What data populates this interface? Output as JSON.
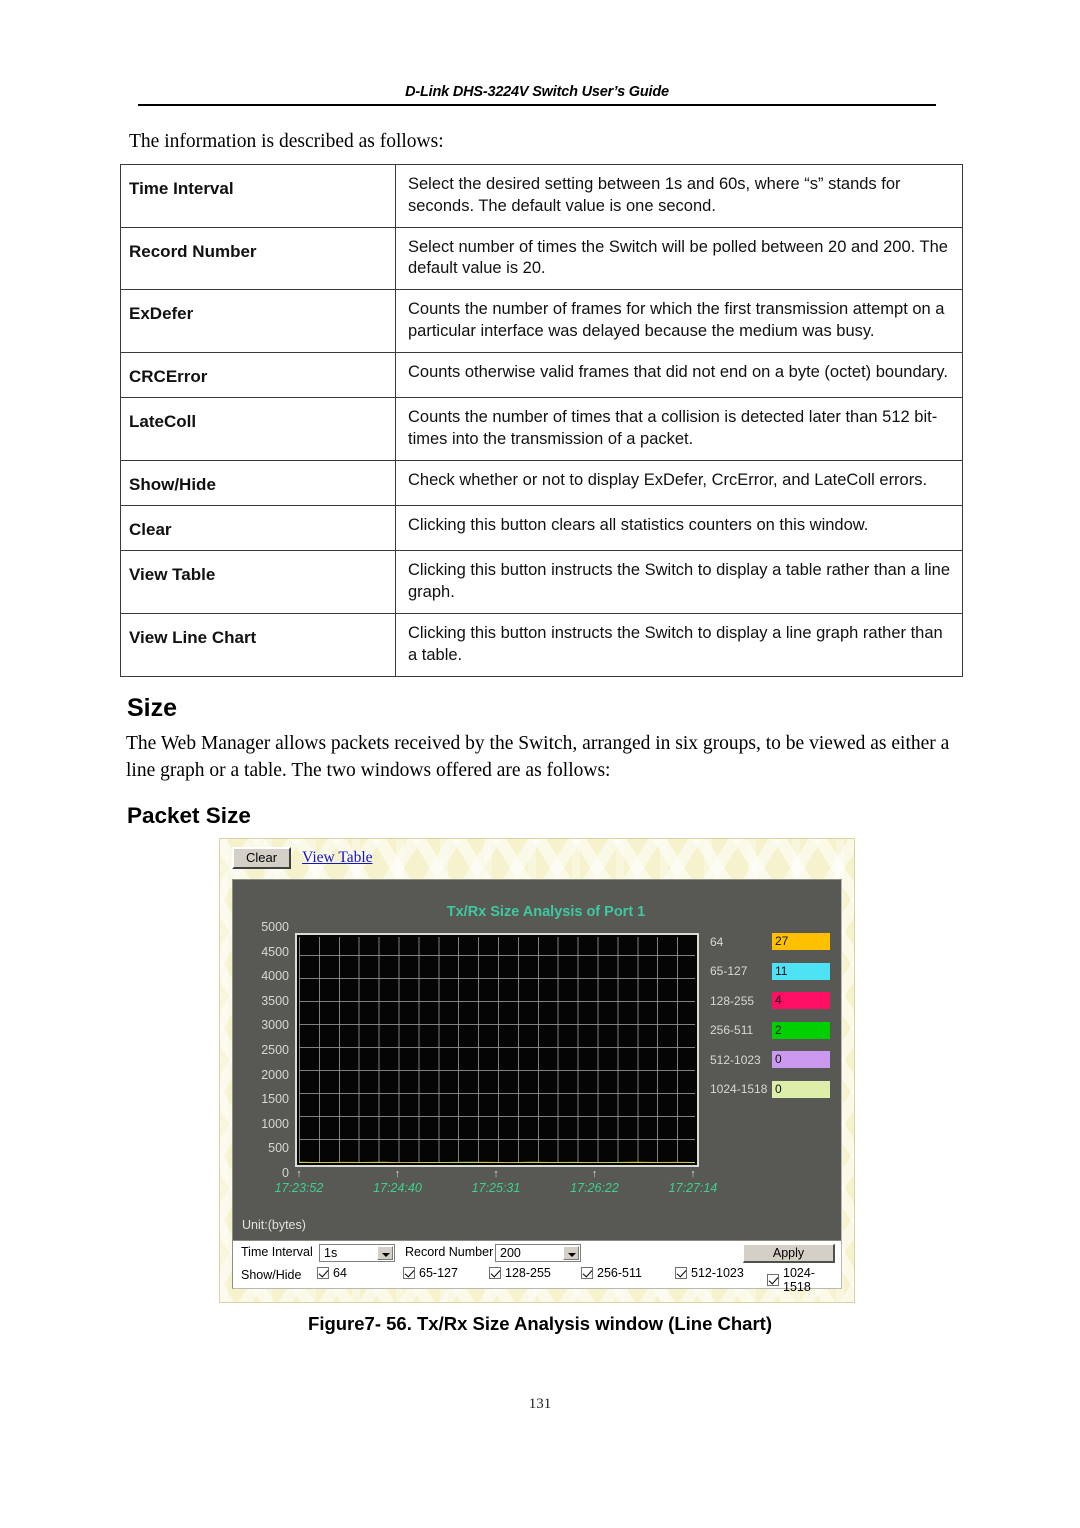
{
  "header": {
    "running_head": "D-Link DHS-3224V Switch User’s Guide"
  },
  "intro_line": "The information is described as follows:",
  "desc_table": {
    "rows": [
      {
        "term": "Time Interval",
        "definition": "Select the desired setting between 1s and 60s, where “s” stands for seconds. The default value is one second."
      },
      {
        "term": "Record Number",
        "definition": "Select number of times the Switch will be polled between 20 and 200. The default value is 20."
      },
      {
        "term": "ExDefer",
        "definition": "Counts the number of frames for which the first transmission attempt on a particular interface was delayed because the medium was busy."
      },
      {
        "term": "CRCError",
        "definition": "Counts otherwise valid frames that did not end on a byte (octet) boundary."
      },
      {
        "term": "LateColl",
        "definition": "Counts the number of times that a collision is detected later than 512 bit-times into the transmission of a packet."
      },
      {
        "term": "Show/Hide",
        "definition": "Check whether or not to display ExDefer, CrcError, and LateColl errors."
      },
      {
        "term": "Clear",
        "definition": "Clicking this button clears all statistics counters on this window."
      },
      {
        "term": "View Table",
        "definition": "Clicking this button instructs the Switch to display a table rather than a line graph."
      },
      {
        "term": "View Line Chart",
        "definition": "Clicking this button instructs the Switch to display a line graph rather than a table."
      }
    ]
  },
  "sections": {
    "size_heading": "Size",
    "size_paragraph": "The Web Manager allows packets received by the Switch, arranged in six groups, to be viewed as either a line graph or a table. The two windows offered are as follows:",
    "packet_size_heading": "Packet Size"
  },
  "screenshot": {
    "toolbar": {
      "clear_label": "Clear",
      "view_table_label": "View Table"
    },
    "unit_label": "Unit:(bytes)",
    "controls": {
      "time_interval_label": "Time Interval",
      "time_interval_value": "1s",
      "record_number_label": "Record Number",
      "record_number_value": "200",
      "apply_label": "Apply",
      "show_hide_label": "Show/Hide",
      "checkboxes": [
        {
          "label": "64",
          "checked": true
        },
        {
          "label": "65-127",
          "checked": true
        },
        {
          "label": "128-255",
          "checked": true
        },
        {
          "label": "256-511",
          "checked": true
        },
        {
          "label": "512-1023",
          "checked": true
        },
        {
          "label": "1024-1518",
          "checked": true
        }
      ]
    }
  },
  "chart_data": {
    "type": "line",
    "title": "Tx/Rx Size Analysis of Port 1",
    "xlabel": "",
    "ylabel": "",
    "unit": "Unit:(bytes)",
    "ylim": [
      0,
      5000
    ],
    "yticks": [
      5000,
      4500,
      4000,
      3500,
      3000,
      2500,
      2000,
      1500,
      1000,
      500,
      0
    ],
    "xticks": [
      "17:23:52",
      "17:24:40",
      "17:25:31",
      "17:26:22",
      "17:27:14"
    ],
    "grid": true,
    "legend_position": "right",
    "plot_background": "#050505",
    "panel_background": "#585855",
    "title_color": "#3ec9a0",
    "xtick_color": "#3fd08a",
    "series": [
      {
        "name": "64",
        "current_value": 27,
        "color": "#ffc000",
        "values": [
          30,
          24,
          29,
          26,
          31,
          22,
          27,
          25,
          33,
          28,
          24,
          30,
          26,
          29,
          23,
          27,
          31,
          25,
          28,
          27
        ]
      },
      {
        "name": "65-127",
        "current_value": 11,
        "color": "#4de3f5",
        "values": [
          12,
          9,
          14,
          10,
          13,
          8,
          11,
          12,
          15,
          9,
          11,
          13,
          10,
          12,
          9,
          14,
          11,
          10,
          13,
          11
        ]
      },
      {
        "name": "128-255",
        "current_value": 4,
        "color": "#ff0f63",
        "values": [
          5,
          3,
          6,
          2,
          4,
          7,
          3,
          5,
          4,
          2,
          6,
          3,
          5,
          4,
          3,
          5,
          2,
          4,
          6,
          4
        ]
      },
      {
        "name": "256-511",
        "current_value": 2,
        "color": "#00d000",
        "values": [
          2,
          1,
          3,
          2,
          1,
          2,
          4,
          2,
          1,
          3,
          2,
          1,
          2,
          3,
          2,
          1,
          2,
          3,
          1,
          2
        ]
      },
      {
        "name": "512-1023",
        "current_value": 0,
        "color": "#cc99f0",
        "values": [
          0,
          0,
          1,
          0,
          0,
          0,
          0,
          1,
          0,
          0,
          0,
          0,
          0,
          1,
          0,
          0,
          0,
          0,
          0,
          0
        ]
      },
      {
        "name": "1024-1518",
        "current_value": 0,
        "color": "#ddeeaa",
        "values": [
          0,
          0,
          0,
          0,
          0,
          0,
          0,
          0,
          0,
          0,
          0,
          0,
          0,
          0,
          0,
          0,
          0,
          0,
          0,
          0
        ]
      }
    ]
  },
  "caption": "Figure7- 56.  Tx/Rx Size Analysis window (Line Chart)",
  "folio": "131"
}
